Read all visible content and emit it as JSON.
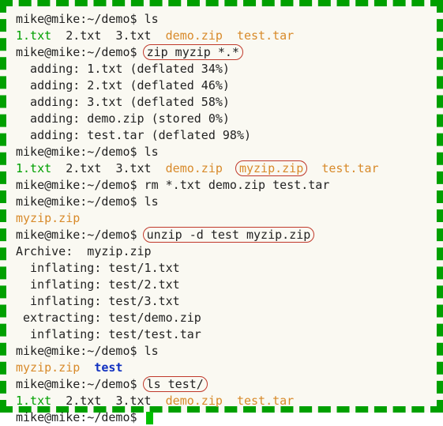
{
  "prompt": "mike@mike:~/demo$",
  "cmd": {
    "ls": "ls",
    "zip": "zip myzip *.*",
    "rm": "rm *.txt demo.zip test.tar",
    "unzip": "unzip -d test myzip.zip",
    "lstest": "ls test/"
  },
  "ls1": {
    "f1": "1.txt",
    "f2": "2.txt",
    "f3": "3.txt",
    "f4": "demo.zip",
    "f5": "test.tar"
  },
  "zipout": {
    "l1": "  adding: 1.txt (deflated 34%)",
    "l2": "  adding: 2.txt (deflated 46%)",
    "l3": "  adding: 3.txt (deflated 58%)",
    "l4": "  adding: demo.zip (stored 0%)",
    "l5": "  adding: test.tar (deflated 98%)"
  },
  "ls2": {
    "f1": "1.txt",
    "f2": "2.txt",
    "f3": "3.txt",
    "f4": "demo.zip",
    "f5": "myzip.zip",
    "f6": "test.tar"
  },
  "ls3": {
    "f1": "myzip.zip"
  },
  "unzipout": {
    "l0": "Archive:  myzip.zip",
    "l1": "  inflating: test/1.txt",
    "l2": "  inflating: test/2.txt",
    "l3": "  inflating: test/3.txt",
    "l4": " extracting: test/demo.zip",
    "l5": "  inflating: test/test.tar"
  },
  "ls4": {
    "f1": "myzip.zip",
    "f2": "test"
  },
  "ls5": {
    "f1": "1.txt",
    "f2": "2.txt",
    "f3": "3.txt",
    "f4": "demo.zip",
    "f5": "test.tar"
  }
}
